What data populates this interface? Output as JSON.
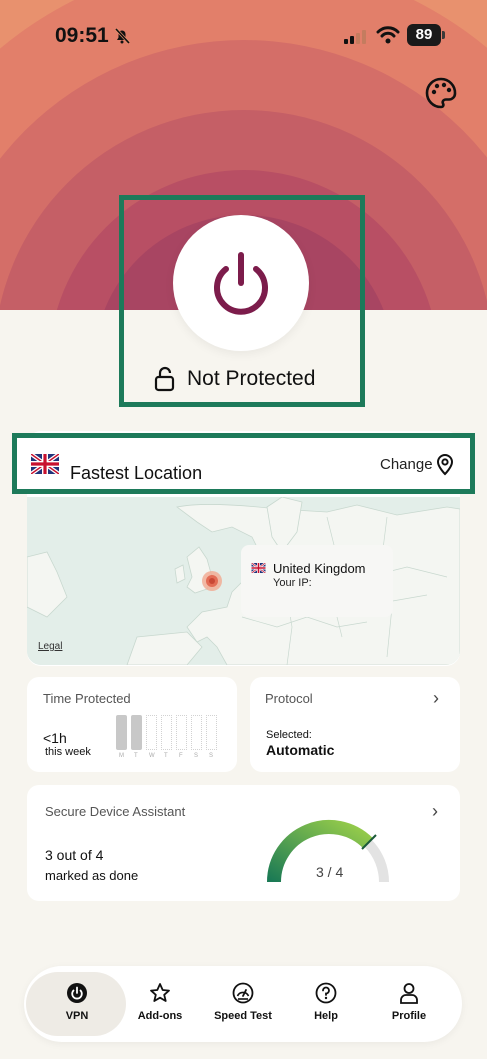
{
  "status_bar": {
    "time": "09:51",
    "battery": "89"
  },
  "hero": {
    "status_label": "Not Protected"
  },
  "location": {
    "title": "Fastest Location",
    "change_label": "Change",
    "map": {
      "country": "United Kingdom",
      "ip_label": "Your IP:",
      "legal": "Legal"
    }
  },
  "time_protected": {
    "title": "Time Protected",
    "value": "<1h",
    "period": "this week",
    "days": [
      "M",
      "T",
      "W",
      "T",
      "F",
      "S",
      "S"
    ]
  },
  "protocol": {
    "title": "Protocol",
    "selected_label": "Selected:",
    "value": "Automatic"
  },
  "assistant": {
    "title": "Secure Device Assistant",
    "progress_text": "3 out of 4",
    "progress_sub": "marked as done",
    "gauge_label": "3 / 4",
    "progress": 0.75
  },
  "nav": {
    "items": [
      {
        "label": "VPN",
        "icon": "power-icon"
      },
      {
        "label": "Add-ons",
        "icon": "star-icon"
      },
      {
        "label": "Speed Test",
        "icon": "speedometer-icon"
      },
      {
        "label": "Help",
        "icon": "help-icon"
      },
      {
        "label": "Profile",
        "icon": "person-icon"
      }
    ]
  },
  "colors": {
    "accent": "#1d7a5a",
    "brand": "#7c1c4b",
    "hero": "#e7906b"
  }
}
